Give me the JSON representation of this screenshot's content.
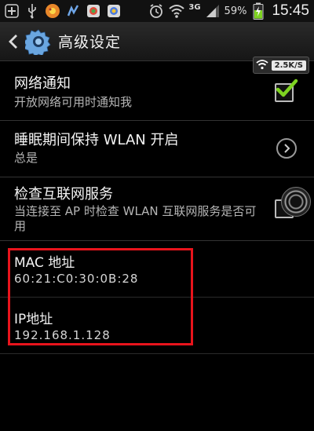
{
  "status_bar": {
    "network": "3G",
    "battery_percent": "59%",
    "time": "15:45",
    "icons": [
      "add-icon",
      "usb-icon",
      "app-icon-1",
      "app-icon-2",
      "app-icon-3",
      "app-icon-4",
      "alarm-icon",
      "wifi-icon",
      "signal-icon",
      "battery-charging-icon"
    ]
  },
  "header": {
    "title": "高级设定",
    "back_icon": "back-chevron-icon",
    "settings_icon": "gear-icon"
  },
  "wifi_speed": {
    "value": "2.5K/S"
  },
  "settings": {
    "network_notify": {
      "title": "网络通知",
      "summary": "开放网络可用时通知我",
      "checked": true
    },
    "keep_wlan_sleep": {
      "title": "睡眠期间保持 WLAN 开启",
      "summary": "总是"
    },
    "check_internet": {
      "title": "检查互联网服务",
      "summary": "当连接至 AP 时检查 WLAN 互联网服务是否可用",
      "checked": false
    }
  },
  "info": {
    "mac": {
      "title": "MAC 地址",
      "value": "60:21:C0:30:0B:28"
    },
    "ip": {
      "title": "IP地址",
      "value": "192.168.1.128"
    }
  },
  "colors": {
    "highlight": "#e8141c",
    "checkmark": "#7ed321",
    "background": "#000000"
  }
}
